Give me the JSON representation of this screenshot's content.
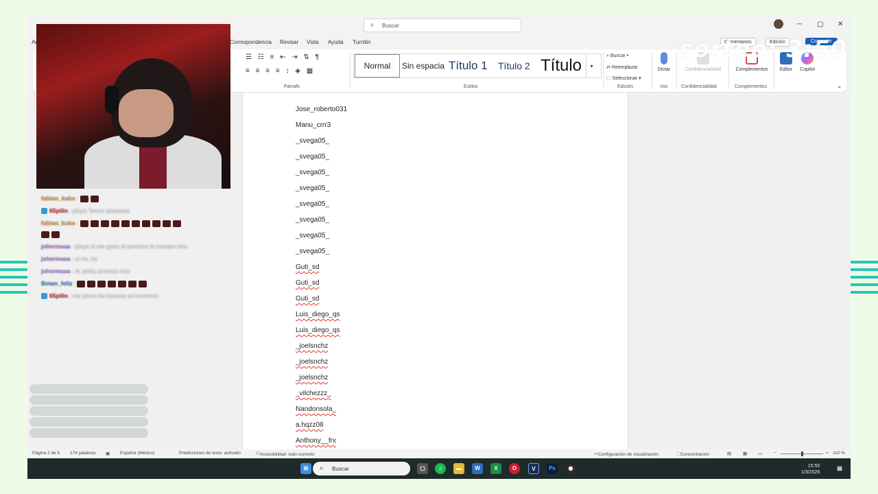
{
  "titlebar": {
    "search_placeholder": "Buscar",
    "minimize": "─",
    "maximize": "▢",
    "close": "✕"
  },
  "tabs": [
    {
      "label": "Ar"
    },
    {
      "label": "Correspondencia"
    },
    {
      "label": "Revisar"
    },
    {
      "label": "Vista"
    },
    {
      "label": "Ayuda"
    },
    {
      "label": "Turnitin"
    }
  ],
  "right_buttons": {
    "comentarios": "Comentarios",
    "edicion": "Edición",
    "compartir": "Compartir"
  },
  "ribbon": {
    "parrafo_label": "Párrafo",
    "estilos_label": "Estilos",
    "edicion_label": "Edición",
    "voz_label": "Voz",
    "confidencialidad_label": "Confidencialidad",
    "complementos_label": "Complementos",
    "styles": {
      "normal": "Normal",
      "sin_espacio": "Sin espacia",
      "titulo1": "Título 1",
      "titulo2": "Título 2",
      "titulo": "Título"
    },
    "buscar": "Buscar",
    "reemplazar": "Reemplazar",
    "seleccionar": "Seleccionar",
    "dictar": "Dictar",
    "confidencialidad_btn": "Confidencialidad",
    "complementos_btn": "Complementos",
    "editor": "Editor",
    "copilot": "Copilot"
  },
  "chat": [
    {
      "user": "fabian_kuko",
      "message": ":",
      "emotes": 2,
      "user_color": "#e0a34a"
    },
    {
      "user": "65pilin",
      "message": ": playo Terrez playaaaa",
      "badge": true,
      "user_color": "#e04444"
    },
    {
      "user": "fabian_kuko",
      "message": ":",
      "emotes": 10,
      "user_color": "#e0a34a"
    },
    {
      "user": "",
      "message": "",
      "emotes": 2,
      "user_color": "#e0a34a"
    },
    {
      "user": "johermaaa",
      "message": ": playo si me gano el perfume le compro otro",
      "user_color": "#b98ae6"
    },
    {
      "user": "johermaaa",
      "message": ": si no, no",
      "user_color": "#b98ae6"
    },
    {
      "user": "johermaaa",
      "message": ": si, pinky promise rica",
      "user_color": "#b98ae6"
    },
    {
      "user": "Botan_feliz",
      "message": ":",
      "emotes": 7,
      "user_color": "#5a8fe0"
    },
    {
      "user": "65pilin",
      "message": ": me pican los huevos mi hermano",
      "badge": true,
      "user_color": "#e04444"
    }
  ],
  "document": {
    "lines": [
      {
        "text": "Jose_roberto031",
        "err": false
      },
      {
        "text": "Manu_crrr3",
        "err": false
      },
      {
        "text": "_svega05_",
        "err": false
      },
      {
        "text": "_svega05_",
        "err": false
      },
      {
        "text": "_svega05_",
        "err": false
      },
      {
        "text": "_svega05_",
        "err": false
      },
      {
        "text": "_svega05_",
        "err": false
      },
      {
        "text": "_svega05_",
        "err": false
      },
      {
        "text": "_svega05_",
        "err": false
      },
      {
        "text": "_svega05_",
        "err": false
      },
      {
        "text": "Guti_sd",
        "err": true
      },
      {
        "text": "Guti_sd",
        "err": true
      },
      {
        "text": "Guti_sd",
        "err": true
      },
      {
        "text": "Luis_diego_qs",
        "err": true
      },
      {
        "text": "Luis_diego_qs",
        "err": true
      },
      {
        "text": "_joelsnchz",
        "err": true
      },
      {
        "text": "_joelsnchz",
        "err": true
      },
      {
        "text": "_joelsnchz",
        "err": true
      },
      {
        "text": "_vilchezzz_",
        "err": true
      },
      {
        "text": "Nandonsola_",
        "err": true
      },
      {
        "text": "a.hqzz08",
        "err": true
      },
      {
        "text": "Anthony__frx",
        "err": true
      }
    ]
  },
  "statusbar": {
    "page": "Página 2 de 5",
    "words": "174 palabras",
    "language": "Español (México)",
    "predictions": "Predicciones de texto: activado",
    "accessibility": "Accesibilidad: todo correcto",
    "display_settings": "Configuración de visualización",
    "focus": "Concentración",
    "zoom": "110 %"
  },
  "taskbar": {
    "search_placeholder": "Buscar",
    "time": "15:55",
    "date": "1/3/2026"
  },
  "overlay": {
    "sorteo": "sorteo: 3:50 pm"
  }
}
